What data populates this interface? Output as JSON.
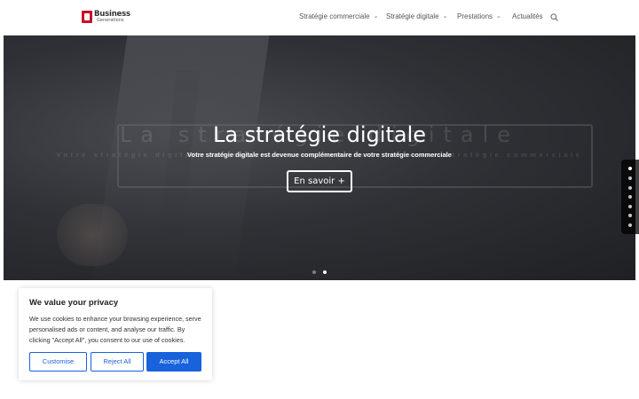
{
  "header": {
    "logo_line1": "Business",
    "logo_line2": "Generations",
    "nav": [
      {
        "label": "Stratégie commerciale"
      },
      {
        "label": "Stratégie digitale"
      },
      {
        "label": "Prestations"
      },
      {
        "label": "Actualités"
      }
    ],
    "search_icon": "search-icon"
  },
  "hero": {
    "title": "La stratégie digitale",
    "subtitle": "Votre stratégie digitale est devenue complémentaire de votre stratégie commerciale",
    "button_label": "En savoir +",
    "slides_total": 2,
    "active_slide": 2
  },
  "side_nav": {
    "dots_total": 7,
    "active_dot": 1
  },
  "cookie": {
    "title": "We value your privacy",
    "text": "We use cookies to enhance your browsing experience, serve personalised ads or content, and analyse our traffic. By clicking \"Accept All\", you consent to our use of cookies.",
    "customise_label": "Customise",
    "reject_label": "Reject All",
    "accept_label": "Accept All",
    "accent_color": "#1863dc"
  }
}
